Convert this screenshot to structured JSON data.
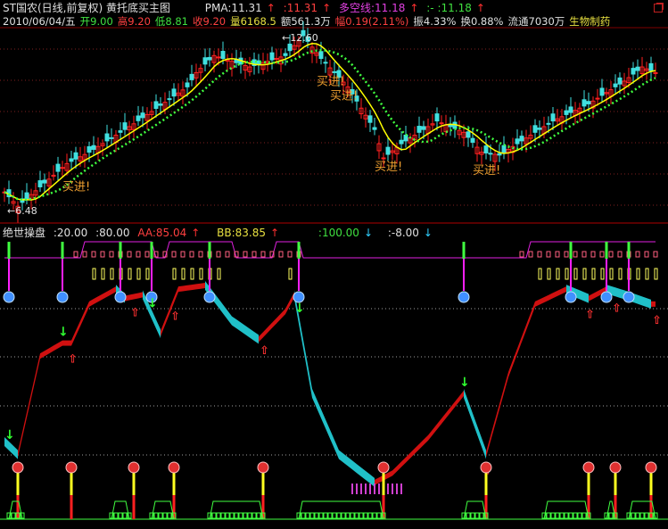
{
  "header": {
    "title": "ST国农(日线,前复权) 黄托底买主图",
    "pma_label": "PMA:11.31",
    "pma2_label": ":11.31",
    "dk_label": "多空线:11.18",
    "dk2_label": ":-  :11.18",
    "up_arrow": "↑",
    "date": "2010/06/04/五",
    "open": "开9.00",
    "high": "高9.20",
    "low": "低8.81",
    "close": "收9.20",
    "volume": "量6168.5",
    "amount": "额561.3万",
    "change": "幅0.19(2.11%)",
    "amplitude": "振4.33%",
    "turnover": "换0.88%",
    "float": "流通7030万",
    "sector": "生物制药"
  },
  "indicator_header": {
    "name": "绝世操盘",
    "v1": ":20.00",
    "v2": ":80.00",
    "aa": "AA:85.04",
    "bb": "BB:83.85",
    "v3": ":100.00",
    "v4": ":-8.00",
    "up_arrow": "↑",
    "down_arrow": "↓"
  },
  "colors": {
    "up": "#ff2020",
    "down": "#40e0e0",
    "ma1": "#ffff00",
    "ma2": "#40ff40",
    "osc_up": "#d01010",
    "osc_down": "#20c0c8",
    "step": "#e020e0"
  },
  "chart_data": [
    {
      "type": "candlestick",
      "title": "ST国农(日线,前复权) 黄托底买主图",
      "bars": 147,
      "close_anchors": [
        [
          0,
          7.1
        ],
        [
          3,
          6.6
        ],
        [
          14,
          8.1
        ],
        [
          19,
          8.5
        ],
        [
          29,
          9.5
        ],
        [
          41,
          10.8
        ],
        [
          43,
          11.3
        ],
        [
          47,
          11.9
        ],
        [
          55,
          11.5
        ],
        [
          63,
          11.9
        ],
        [
          67,
          12.6
        ],
        [
          71,
          11.8
        ],
        [
          77,
          10.8
        ],
        [
          83,
          9.3
        ],
        [
          85,
          8.3
        ],
        [
          89,
          8.8
        ],
        [
          97,
          9.6
        ],
        [
          103,
          9.2
        ],
        [
          107,
          8.5
        ],
        [
          111,
          8.4
        ],
        [
          115,
          8.8
        ],
        [
          123,
          9.6
        ],
        [
          131,
          10.2
        ],
        [
          139,
          11.0
        ],
        [
          143,
          11.5
        ],
        [
          146,
          11.3
        ]
      ],
      "ylim": [
        6.2,
        12.9
      ],
      "high_label": "12.60",
      "low_label": "6.48",
      "annotations": [
        {
          "bar": 14,
          "text": "买进!"
        },
        {
          "bar": 71,
          "text": "买进!"
        },
        {
          "bar": 74,
          "text": "买进!"
        },
        {
          "bar": 84,
          "text": "买进!"
        },
        {
          "bar": 106,
          "text": "买进!"
        }
      ]
    },
    {
      "type": "area",
      "title": "绝世操盘",
      "osc_anchors": [
        [
          0,
          16
        ],
        [
          3,
          9
        ],
        [
          8,
          62
        ],
        [
          13,
          69
        ],
        [
          15,
          69
        ],
        [
          19,
          90
        ],
        [
          25,
          98
        ],
        [
          27,
          93
        ],
        [
          31,
          95
        ],
        [
          35,
          74
        ],
        [
          39,
          98
        ],
        [
          45,
          100
        ],
        [
          51,
          81
        ],
        [
          57,
          71
        ],
        [
          63,
          86
        ],
        [
          65,
          95
        ],
        [
          69,
          42
        ],
        [
          75,
          9
        ],
        [
          83,
          -6
        ],
        [
          87,
          -1
        ],
        [
          95,
          18
        ],
        [
          103,
          42
        ],
        [
          108,
          9
        ],
        [
          113,
          52
        ],
        [
          119,
          90
        ],
        [
          126,
          98
        ],
        [
          131,
          93
        ],
        [
          135,
          98
        ],
        [
          139,
          95
        ],
        [
          145,
          90
        ]
      ],
      "ylim": [
        -8,
        100
      ],
      "top_signals": [
        1,
        13,
        26,
        33,
        46,
        66,
        103,
        127,
        135,
        140
      ],
      "bottom_signals": [
        3,
        15,
        29,
        38,
        58,
        85,
        108,
        131,
        137,
        145
      ],
      "down_arrows": [
        1,
        13,
        33,
        66,
        103
      ],
      "up_arrows": [
        15,
        29,
        38,
        58,
        108,
        131,
        137,
        146
      ]
    }
  ]
}
